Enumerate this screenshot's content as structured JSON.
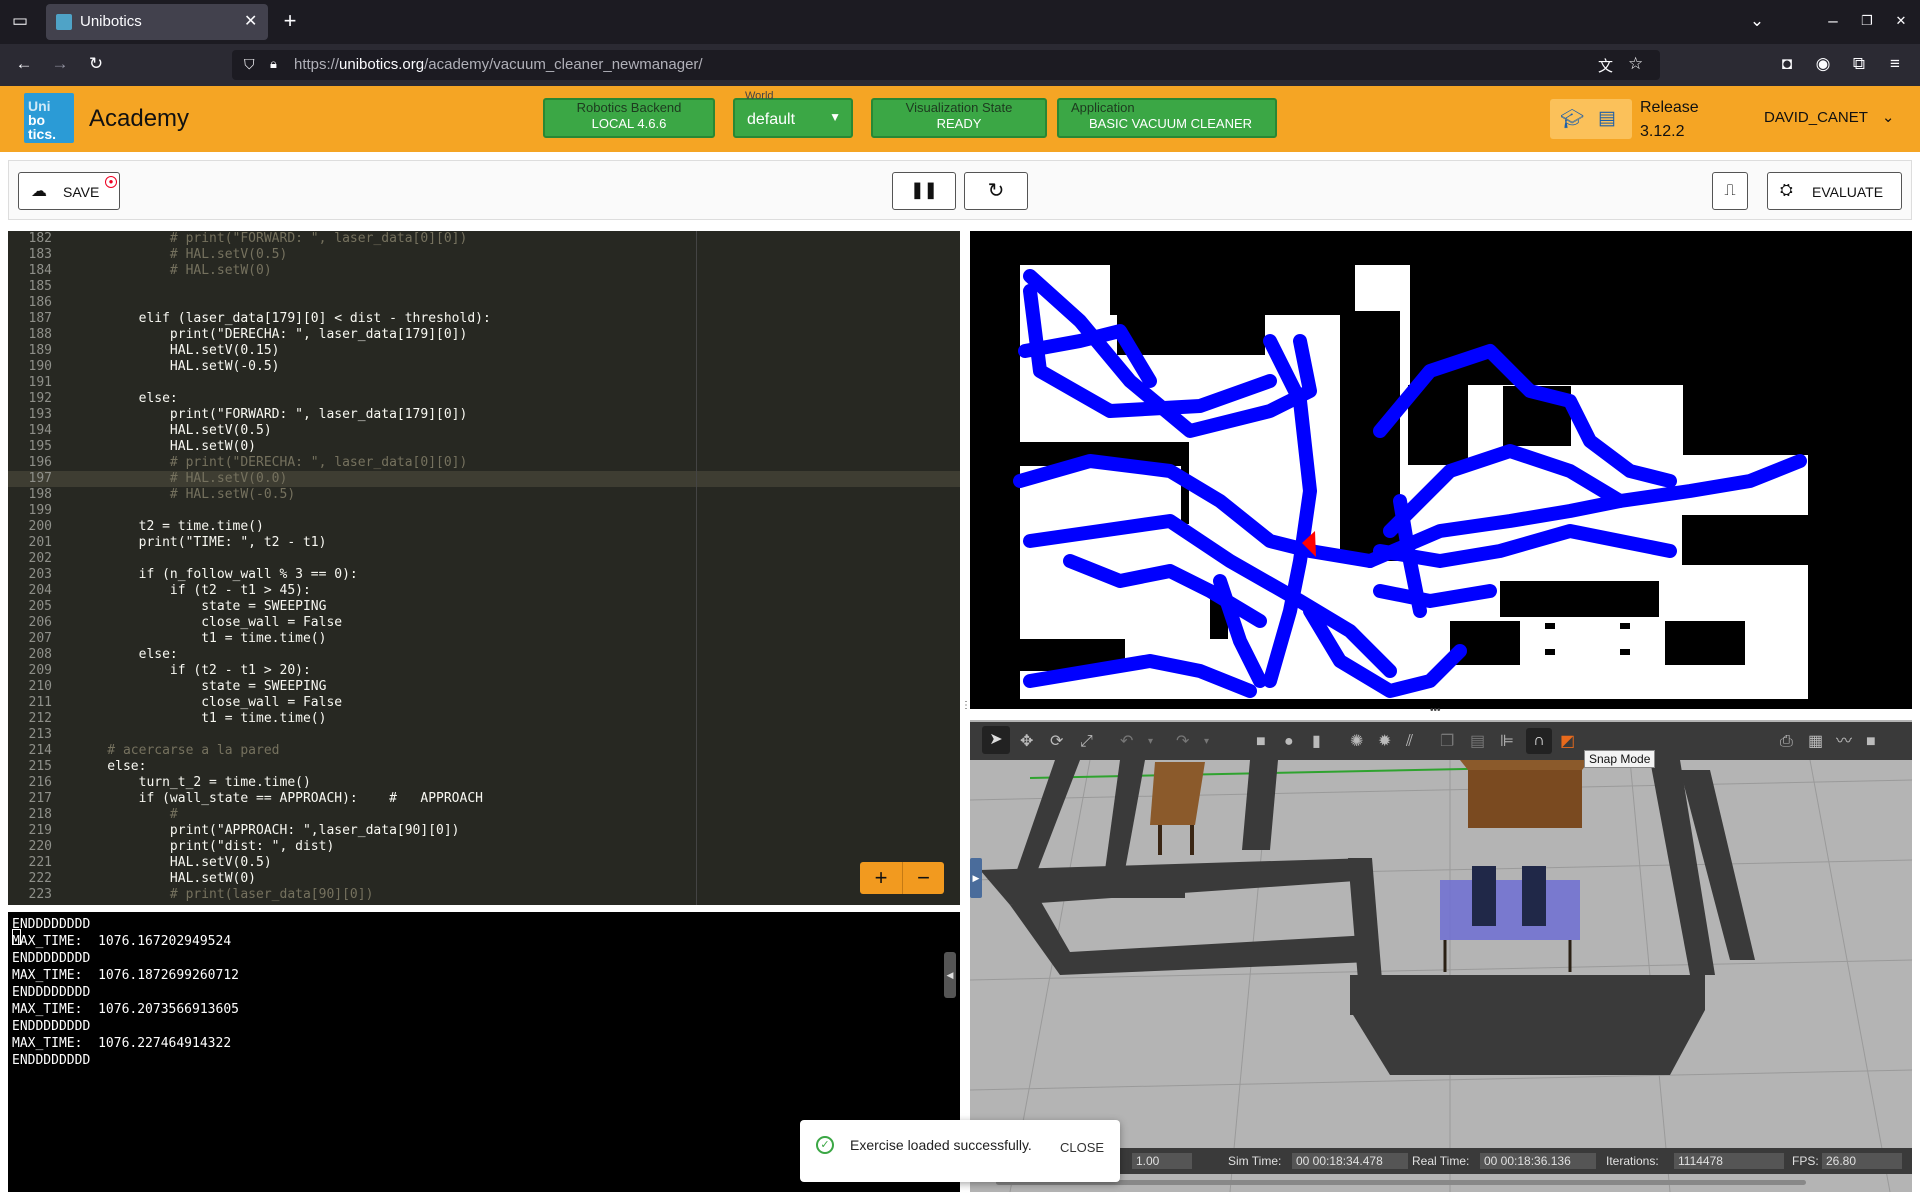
{
  "browser": {
    "tab_title": "Unibotics",
    "url_prefix": "https://",
    "url_domain": "unibotics.org",
    "url_path": "/academy/vacuum_cleaner_newmanager/"
  },
  "header": {
    "logo_text": [
      "Uni",
      "bo",
      "tics."
    ],
    "app_name": "Academy",
    "backend_caption": "Robotics Backend",
    "backend_value": "LOCAL 4.6.6",
    "world_caption": "World",
    "world_value": "default",
    "vis_caption": "Visualization State",
    "vis_value": "READY",
    "application_caption": "Application",
    "application_value": "BASIC VACUUM CLEANER",
    "release_label": "Release",
    "release_version": "3.12.2",
    "user": "DAVID_CANET",
    "accent": "#f5a524",
    "green": "#3ba745"
  },
  "toolbar": {
    "save_label": "SAVE",
    "evaluate_label": "EVALUATE"
  },
  "editor": {
    "lines": [
      {
        "n": "182",
        "code": "            # print(\"FORWARD: \", laser_data[0][0])",
        "c": true
      },
      {
        "n": "183",
        "code": "            # HAL.setV(0.5)",
        "c": true
      },
      {
        "n": "184",
        "code": "            # HAL.setW(0)",
        "c": true
      },
      {
        "n": "185",
        "code": ""
      },
      {
        "n": "186",
        "code": ""
      },
      {
        "n": "187",
        "code": "        elif (laser_data[179][0] < dist - threshold):"
      },
      {
        "n": "188",
        "code": "            print(\"DERECHA: \", laser_data[179][0])"
      },
      {
        "n": "189",
        "code": "            HAL.setV(0.15)"
      },
      {
        "n": "190",
        "code": "            HAL.setW(-0.5)"
      },
      {
        "n": "191",
        "code": ""
      },
      {
        "n": "192",
        "code": "        else:"
      },
      {
        "n": "193",
        "code": "            print(\"FORWARD: \", laser_data[179][0])"
      },
      {
        "n": "194",
        "code": "            HAL.setV(0.5)"
      },
      {
        "n": "195",
        "code": "            HAL.setW(0)"
      },
      {
        "n": "196",
        "code": "            # print(\"DERECHA: \", laser_data[0][0])",
        "c": true
      },
      {
        "n": "197",
        "code": "            # HAL.setV(0.0)",
        "c": true
      },
      {
        "n": "198",
        "code": "            # HAL.setW(-0.5)",
        "c": true
      },
      {
        "n": "199",
        "code": ""
      },
      {
        "n": "200",
        "code": "        t2 = time.time()"
      },
      {
        "n": "201",
        "code": "        print(\"TIME: \", t2 - t1)"
      },
      {
        "n": "202",
        "code": ""
      },
      {
        "n": "203",
        "code": "        if (n_follow_wall % 3 == 0):"
      },
      {
        "n": "204",
        "code": "            if (t2 - t1 > 45):"
      },
      {
        "n": "205",
        "code": "                state = SWEEPING"
      },
      {
        "n": "206",
        "code": "                close_wall = False"
      },
      {
        "n": "207",
        "code": "                t1 = time.time()"
      },
      {
        "n": "208",
        "code": "        else:"
      },
      {
        "n": "209",
        "code": "            if (t2 - t1 > 20):"
      },
      {
        "n": "210",
        "code": "                state = SWEEPING"
      },
      {
        "n": "211",
        "code": "                close_wall = False"
      },
      {
        "n": "212",
        "code": "                t1 = time.time()"
      },
      {
        "n": "213",
        "code": ""
      },
      {
        "n": "214",
        "code": "    # acercarse a la pared",
        "c": true
      },
      {
        "n": "215",
        "code": "    else:"
      },
      {
        "n": "216",
        "code": "        turn_t_2 = time.time()"
      },
      {
        "n": "217",
        "code": "        if (wall_state == APPROACH):    #   APPROACH"
      },
      {
        "n": "218",
        "code": "            #",
        "c": true
      },
      {
        "n": "219",
        "code": "            print(\"APPROACH: \",laser_data[90][0])"
      },
      {
        "n": "220",
        "code": "            print(\"dist: \", dist)"
      },
      {
        "n": "221",
        "code": "            HAL.setV(0.5)"
      },
      {
        "n": "222",
        "code": "            HAL.setW(0)"
      },
      {
        "n": "223",
        "code": "            # print(laser_data[90][0])",
        "c": true
      }
    ]
  },
  "console": {
    "lines": [
      "ENDDDDDDDD",
      "MAX_TIME:  1076.167202949524",
      "ENDDDDDDDD",
      "MAX_TIME:  1076.1872699260712",
      "ENDDDDDDDD",
      "MAX_TIME:  1076.2073566913605",
      "ENDDDDDDDD",
      "MAX_TIME:  1076.227464914322",
      "ENDDDDDDDD"
    ]
  },
  "sim": {
    "tooltip": "Snap Mode",
    "factor_value": "1.00",
    "sim_time_label": "Sim Time:",
    "sim_time_value": "00 00:18:34.478",
    "real_time_label": "Real Time:",
    "real_time_value": "00 00:18:36.136",
    "iterations_label": "Iterations:",
    "iterations_value": "1114478",
    "fps_label": "FPS:",
    "fps_value": "26.80"
  },
  "toast": {
    "message": "Exercise loaded successfully.",
    "close_label": "CLOSE"
  }
}
